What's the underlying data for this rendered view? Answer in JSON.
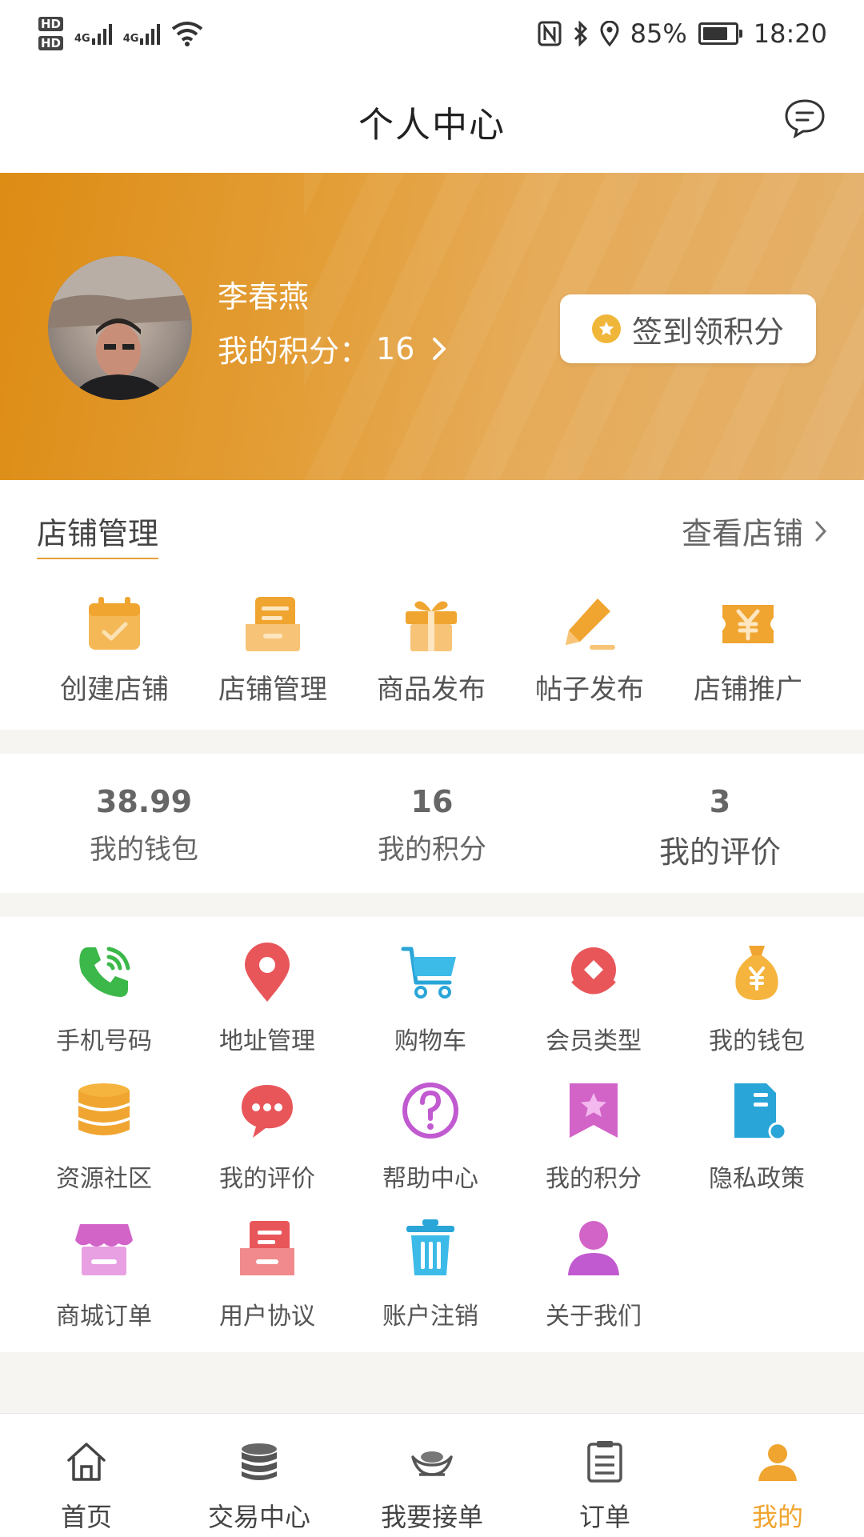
{
  "status_bar": {
    "battery": "85%",
    "time": "18:20",
    "network": "4G"
  },
  "header": {
    "title": "个人中心"
  },
  "profile": {
    "name": "李春燕",
    "points_label": "我的积分：",
    "points_value": "16",
    "signin_label": "签到领积分"
  },
  "store": {
    "title": "店铺管理",
    "view_label": "查看店铺",
    "items": [
      {
        "label": "创建店铺",
        "icon": "calendar-check-icon"
      },
      {
        "label": "店铺管理",
        "icon": "document-icon"
      },
      {
        "label": "商品发布",
        "icon": "gift-icon"
      },
      {
        "label": "帖子发布",
        "icon": "pen-icon"
      },
      {
        "label": "店铺推广",
        "icon": "yen-ticket-icon"
      }
    ]
  },
  "stats": [
    {
      "value": "38.99",
      "label": "我的钱包"
    },
    {
      "value": "16",
      "label": "我的积分"
    },
    {
      "value": "3",
      "label": "我的评价"
    }
  ],
  "functions": [
    {
      "label": "手机号码",
      "icon": "phone-icon"
    },
    {
      "label": "地址管理",
      "icon": "location-pin-icon"
    },
    {
      "label": "购物车",
      "icon": "cart-icon"
    },
    {
      "label": "会员类型",
      "icon": "member-badge-icon"
    },
    {
      "label": "我的钱包",
      "icon": "money-bag-icon"
    },
    {
      "label": "资源社区",
      "icon": "database-icon"
    },
    {
      "label": "我的评价",
      "icon": "chat-bubble-icon"
    },
    {
      "label": "帮助中心",
      "icon": "question-icon"
    },
    {
      "label": "我的积分",
      "icon": "star-bookmark-icon"
    },
    {
      "label": "隐私政策",
      "icon": "privacy-doc-icon"
    },
    {
      "label": "商城订单",
      "icon": "shop-icon"
    },
    {
      "label": "用户协议",
      "icon": "agreement-icon"
    },
    {
      "label": "账户注销",
      "icon": "trash-icon"
    },
    {
      "label": "关于我们",
      "icon": "user-icon"
    }
  ],
  "tabs": [
    {
      "label": "首页",
      "icon": "home-icon"
    },
    {
      "label": "交易中心",
      "icon": "coins-icon"
    },
    {
      "label": "我要接单",
      "icon": "ingot-icon"
    },
    {
      "label": "订单",
      "icon": "clipboard-icon"
    },
    {
      "label": "我的",
      "icon": "user-icon",
      "active": true
    }
  ],
  "colors": {
    "accent": "#f0a530",
    "banner": "#dd8c14"
  }
}
